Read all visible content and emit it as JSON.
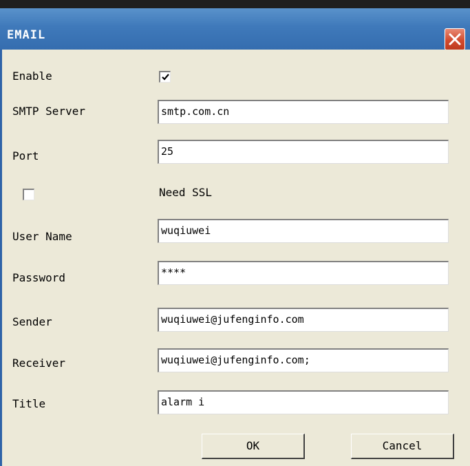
{
  "window": {
    "title": "EMAIL",
    "close_icon": "close-icon"
  },
  "form": {
    "enable": {
      "label": "Enable",
      "checked": true
    },
    "smtp_server": {
      "label": "SMTP Server",
      "value": "smtp.com.cn"
    },
    "port": {
      "label": "Port",
      "value": "25"
    },
    "need_ssl": {
      "label": "Need SSL",
      "checked": false
    },
    "user_name": {
      "label": "User Name",
      "value": "wuqiuwei"
    },
    "password": {
      "label": "Password",
      "value": "****"
    },
    "sender": {
      "label": "Sender",
      "value": "wuqiuwei@jufenginfo.com"
    },
    "receiver": {
      "label": "Receiver",
      "value": "wuqiuwei@jufenginfo.com;"
    },
    "title": {
      "label": "Title",
      "value": "alarm i"
    }
  },
  "buttons": {
    "ok_label": "OK",
    "cancel_label": "Cancel"
  },
  "colors": {
    "titlebar": "#3F79BA",
    "client_bg": "#ECE9D8",
    "close_button": "#D24C2F"
  }
}
